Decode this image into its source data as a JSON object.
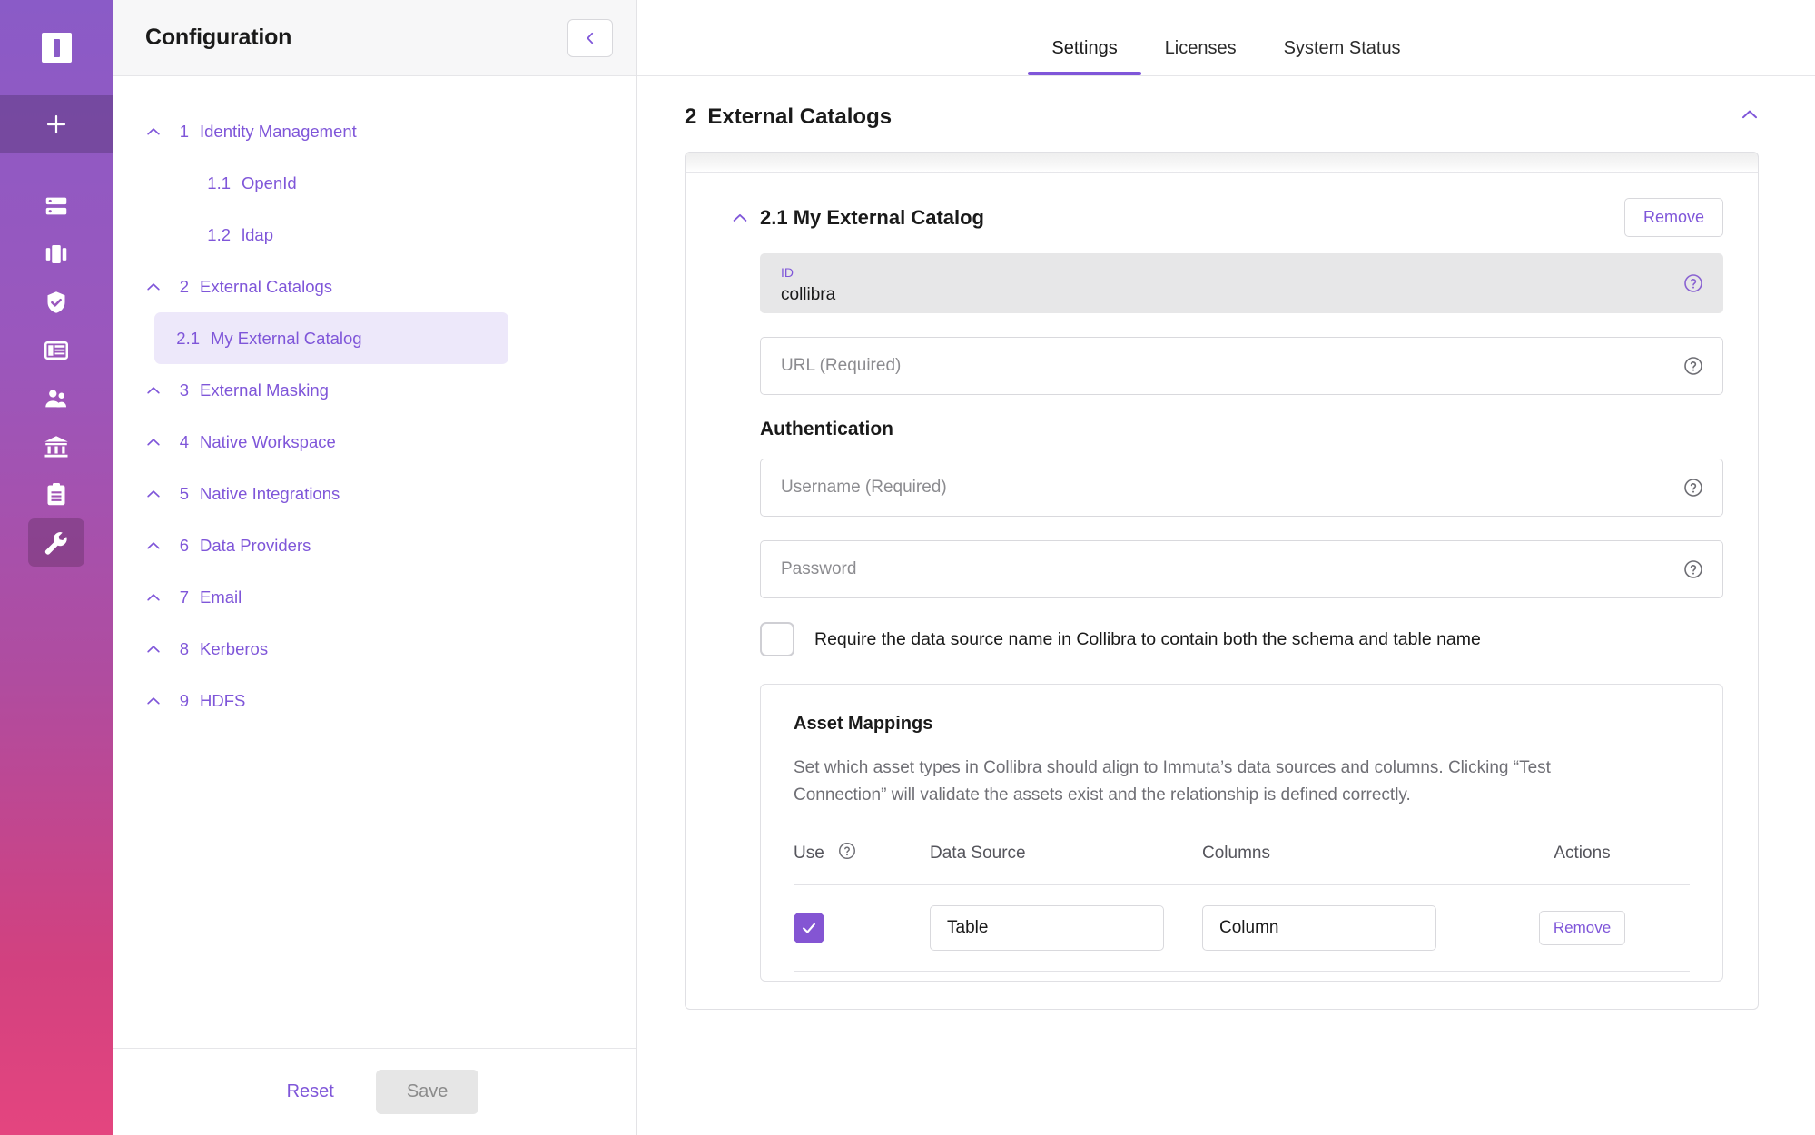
{
  "rail": {
    "logo_name": "immuta-logo",
    "add_label": "+",
    "items": [
      {
        "name": "data-sources-icon",
        "label": "Data Sources"
      },
      {
        "name": "projects-icon",
        "label": "Projects"
      },
      {
        "name": "policies-shield-icon",
        "label": "Policies"
      },
      {
        "name": "dashboards-icon",
        "label": "Dashboards"
      },
      {
        "name": "people-icon",
        "label": "People"
      },
      {
        "name": "governance-bank-icon",
        "label": "Governance"
      },
      {
        "name": "audit-clipboard-icon",
        "label": "Audit"
      },
      {
        "name": "app-settings-wrench-icon",
        "label": "App Settings"
      }
    ]
  },
  "topnav": {
    "tabs": [
      {
        "label": "Settings",
        "active": true
      },
      {
        "label": "Licenses",
        "active": false
      },
      {
        "label": "System Status",
        "active": false
      }
    ]
  },
  "config": {
    "title": "Configuration",
    "collapse_icon": "chevron-left-icon",
    "tree": [
      {
        "num": "1",
        "label": "Identity Management",
        "level": 0,
        "selected": false,
        "caret": "chevron-up-icon"
      },
      {
        "num": "1.1",
        "label": "OpenId",
        "level": 1,
        "selected": false,
        "caret": ""
      },
      {
        "num": "1.2",
        "label": "ldap",
        "level": 1,
        "selected": false,
        "caret": ""
      },
      {
        "num": "2",
        "label": "External Catalogs",
        "level": 0,
        "selected": false,
        "caret": "chevron-up-icon"
      },
      {
        "num": "2.1",
        "label": "My External Catalog",
        "level": 1,
        "selected": true,
        "caret": ""
      },
      {
        "num": "3",
        "label": "External Masking",
        "level": 0,
        "selected": false,
        "caret": "chevron-up-icon"
      },
      {
        "num": "4",
        "label": "Native Workspace",
        "level": 0,
        "selected": false,
        "caret": "chevron-up-icon"
      },
      {
        "num": "5",
        "label": "Native Integrations",
        "level": 0,
        "selected": false,
        "caret": "chevron-up-icon"
      },
      {
        "num": "6",
        "label": "Data Providers",
        "level": 0,
        "selected": false,
        "caret": "chevron-up-icon"
      },
      {
        "num": "7",
        "label": "Email",
        "level": 0,
        "selected": false,
        "caret": "chevron-up-icon"
      },
      {
        "num": "8",
        "label": "Kerberos",
        "level": 0,
        "selected": false,
        "caret": "chevron-up-icon"
      },
      {
        "num": "9",
        "label": "HDFS",
        "level": 0,
        "selected": false,
        "caret": "chevron-up-icon"
      }
    ],
    "reset_label": "Reset",
    "save_label": "Save"
  },
  "section": {
    "number": "2",
    "title": "External Catalogs",
    "collapse_icon": "chevron-up-icon"
  },
  "catalog": {
    "number": "2.1",
    "title": "My External Catalog",
    "remove_label": "Remove",
    "id_field": {
      "label": "ID",
      "value": "collibra",
      "help_icon": "help-circle-icon"
    },
    "url_field": {
      "placeholder": "URL (Required)",
      "value": "",
      "help_icon": "help-circle-icon"
    },
    "auth_title": "Authentication",
    "username_field": {
      "placeholder": "Username (Required)",
      "value": "",
      "help_icon": "help-circle-icon"
    },
    "password_field": {
      "placeholder": "Password",
      "value": "",
      "help_icon": "help-circle-icon"
    },
    "schema_checkbox": {
      "checked": false,
      "label": "Require the data source name in Collibra to contain both the schema and table name"
    }
  },
  "asset_mappings": {
    "title": "Asset Mappings",
    "description": "Set which asset types in Collibra should align to Immuta’s data sources and columns. Clicking “Test Connection” will validate the assets exist and the relationship is defined correctly.",
    "columns": [
      "Use",
      "Data Source",
      "Columns",
      "Actions"
    ],
    "use_help_icon": "help-circle-icon",
    "rows": [
      {
        "use": true,
        "data_source": "Table",
        "columns": "Column",
        "action_label": "Remove"
      }
    ]
  },
  "colors": {
    "accent_purple": "#7f56d9",
    "checkbox_purple": "#8455d3",
    "rail_gradient_top": "#8a5bc7",
    "rail_gradient_bottom": "#e4457f",
    "selected_row_bg": "#ede8fa",
    "disabled_field_bg": "#e7e7e8",
    "save_disabled_bg": "#e6e6e6"
  }
}
